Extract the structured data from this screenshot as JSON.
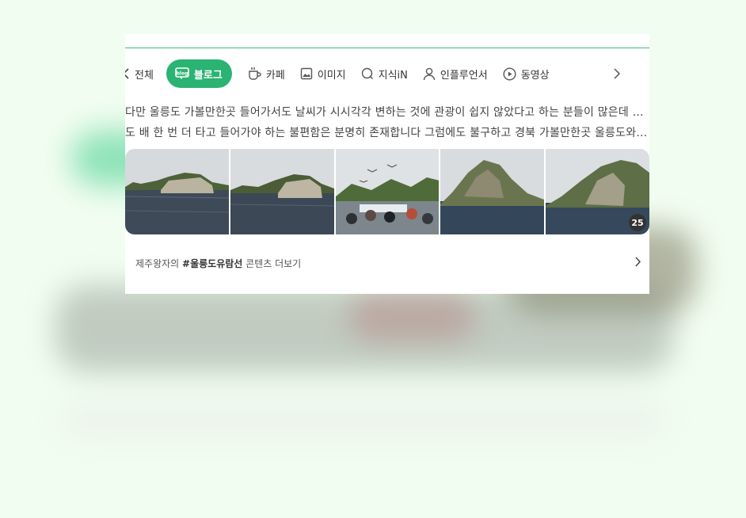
{
  "tabs": [
    {
      "label": "전체",
      "icon": "chevron-left-icon"
    },
    {
      "label": "블로그",
      "icon": "blog-icon",
      "active": true
    },
    {
      "label": "카페",
      "icon": "cafe-cup-icon"
    },
    {
      "label": "이미지",
      "icon": "image-icon"
    },
    {
      "label": "지식iN",
      "icon": "knowledge-icon"
    },
    {
      "label": "인플루언서",
      "icon": "person-icon"
    },
    {
      "label": "동영상",
      "icon": "play-icon"
    }
  ],
  "tab_next_icon": "chevron-right-icon",
  "snippet": {
    "line1": "다만 울릉도 가볼만한곳 들어가서도 날씨가 시시각각 변하는 것에 관광이 쉽지 않았다고 하는 분들이 많은데 울릉",
    "line2": "도 배 한 번 더 타고 들어가야 하는 불편함은 분명히 존재합니다 그럼에도 불구하고 경북 가볼만한곳 울릉도와 독..."
  },
  "photos": {
    "count": "25"
  },
  "more": {
    "prefix": "제주왕자의",
    "tag": "#울릉도유람선",
    "suffix": "콘텐츠 더보기"
  },
  "colors": {
    "accent": "#2ab373",
    "background": "#f1fdf0"
  }
}
